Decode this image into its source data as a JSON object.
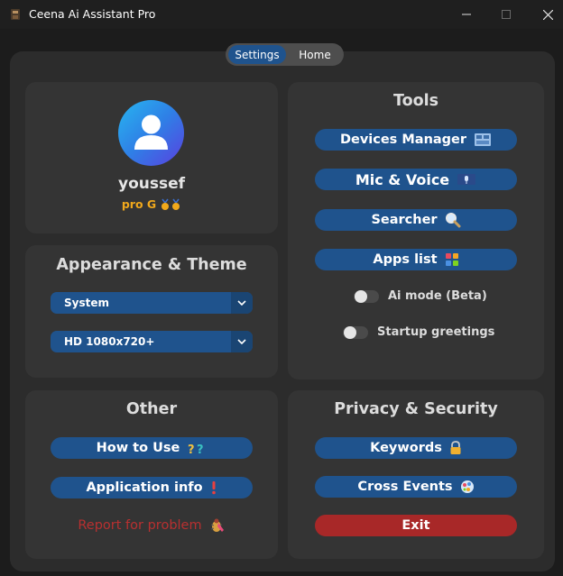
{
  "window": {
    "title": "Ceena Ai Assistant Pro"
  },
  "nav": {
    "settings": "Settings",
    "home": "Home"
  },
  "profile": {
    "name": "youssef",
    "tier": "pro G"
  },
  "appearance": {
    "title": "Appearance & Theme",
    "theme_value": "System",
    "resolution_value": "HD 1080x720+"
  },
  "tools": {
    "title": "Tools",
    "devices_manager": "Devices Manager",
    "mic_voice": "Mic & Voice",
    "searcher": "Searcher",
    "apps_list": "Apps list",
    "ai_mode": "Ai mode (Beta)",
    "ai_mode_on": false,
    "startup_greetings": "Startup greetings",
    "startup_greetings_on": false
  },
  "other": {
    "title": "Other",
    "how_to_use": "How to Use",
    "application_info": "Application info",
    "report_problem": "Report for problem"
  },
  "privacy": {
    "title": "Privacy & Security",
    "keywords": "Keywords",
    "cross_events": "Cross Events",
    "exit": "Exit"
  },
  "colors": {
    "accent": "#1f538d",
    "danger": "#a82828",
    "gold": "#f0a81c",
    "report_red": "#b83030"
  },
  "icons": [
    "app-icon",
    "minimize-icon",
    "maximize-icon",
    "close-icon",
    "user-avatar-icon",
    "medal-icon",
    "chevron-down-icon",
    "device-icon",
    "microphone-icon",
    "magnifier-icon",
    "apps-grid-icon",
    "question-marks-icon",
    "exclamation-icon",
    "bug-icon",
    "lock-icon",
    "globe-icon"
  ]
}
